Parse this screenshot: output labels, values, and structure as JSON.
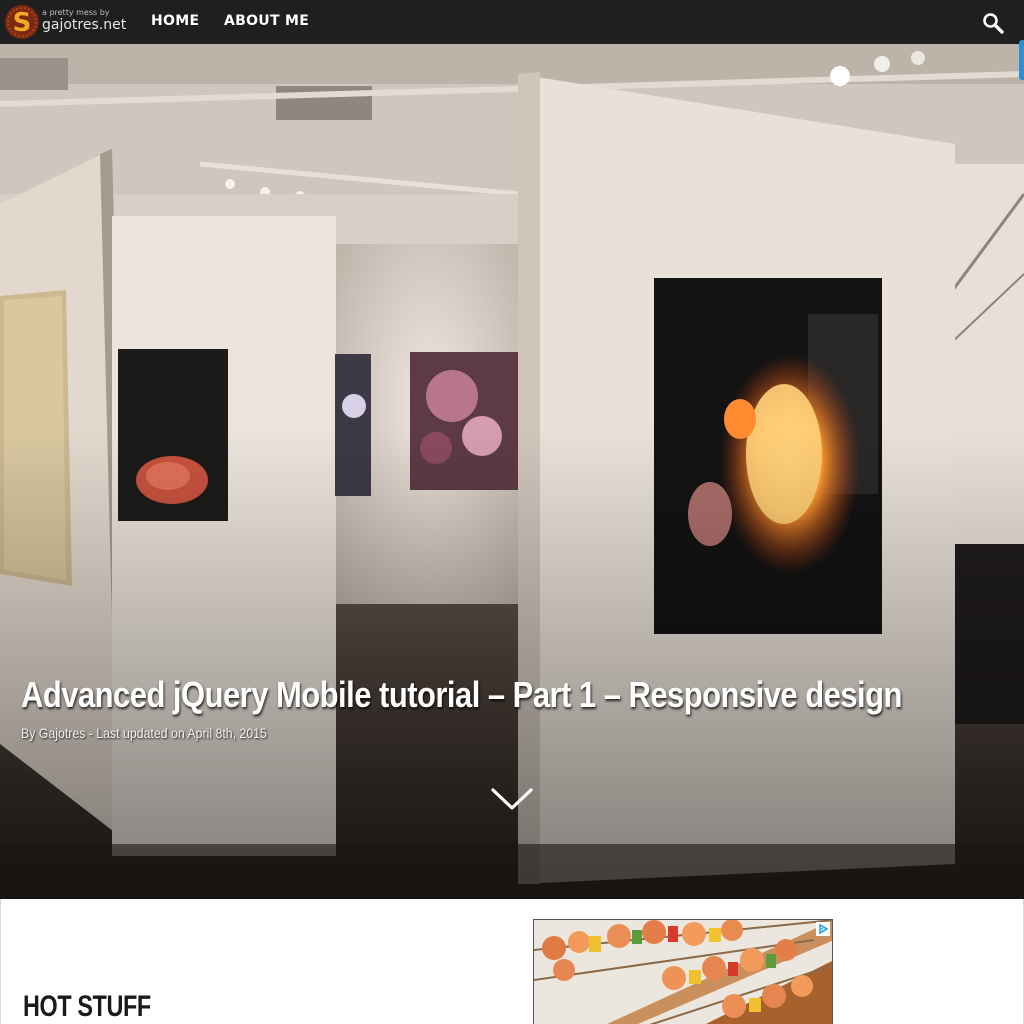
{
  "site": {
    "tagline": "a pretty mess by",
    "name": "gajotres.net",
    "logo_icon": "site-logo-icon"
  },
  "nav": {
    "items": [
      {
        "label": "HOME"
      },
      {
        "label": "ABOUT ME"
      }
    ],
    "search_icon": "search-icon"
  },
  "hero": {
    "title": "Advanced jQuery Mobile tutorial – Part 1 – Responsive design",
    "meta": "By Gajotres -  Last updated on April 8th, 2015",
    "scroll_icon": "chevron-down-icon"
  },
  "content": {
    "section_heading": "HOT STUFF",
    "ad_icon": "adchoices-icon"
  },
  "colors": {
    "navbar": "#1f1f1f",
    "edge_tab": "#2a8fd6"
  }
}
